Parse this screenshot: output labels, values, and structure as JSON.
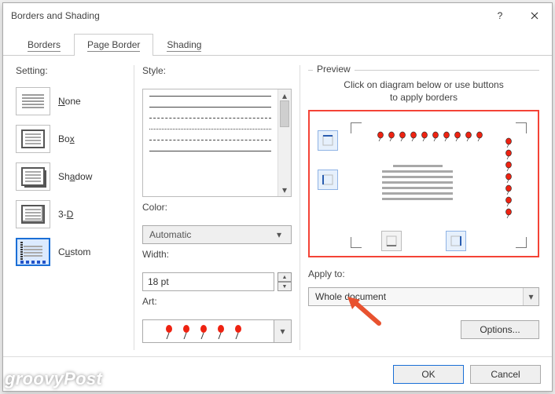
{
  "window": {
    "title": "Borders and Shading"
  },
  "tabs": {
    "borders": "Borders",
    "page_border": "Page Border",
    "shading": "Shading",
    "active": "page_border"
  },
  "setting": {
    "label": "Setting:",
    "options": [
      {
        "id": "none",
        "label_pre": "",
        "ul": "N",
        "label_post": "one"
      },
      {
        "id": "box",
        "label_pre": "Bo",
        "ul": "x",
        "label_post": ""
      },
      {
        "id": "shadow",
        "label_pre": "Sh",
        "ul": "a",
        "label_post": "dow"
      },
      {
        "id": "3d",
        "label_pre": "3-",
        "ul": "D",
        "label_post": ""
      },
      {
        "id": "custom",
        "label_pre": "C",
        "ul": "u",
        "label_post": "stom"
      }
    ],
    "selected": "custom"
  },
  "style": {
    "label": "Style:",
    "color_label": "Color:",
    "color_value": "Automatic",
    "width_label": "Width:",
    "width_value": "18 pt",
    "art_label": "Art:"
  },
  "preview": {
    "label": "Preview",
    "hint_line1": "Click on diagram below or use buttons",
    "hint_line2": "to apply borders"
  },
  "apply_to": {
    "label": "Apply to:",
    "value": "Whole document"
  },
  "buttons": {
    "options": "Options...",
    "ok": "OK",
    "cancel": "Cancel"
  },
  "watermark": "groovyPost"
}
